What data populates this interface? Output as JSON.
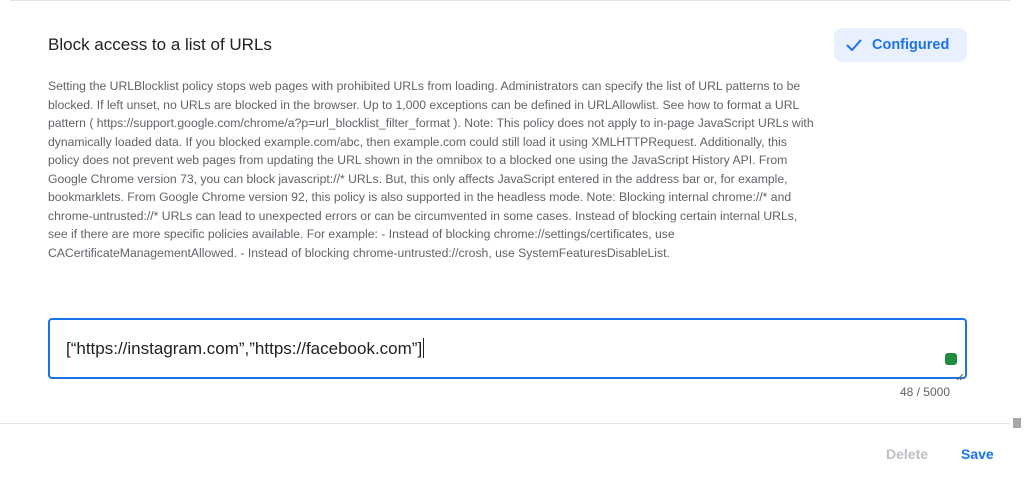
{
  "policy": {
    "title": "Block access to a list of URLs",
    "status_label": "Configured",
    "description": "Setting the URLBlocklist policy stops web pages with prohibited URLs from loading. Administrators can specify the list of URL patterns to be blocked. If left unset, no URLs are blocked in the browser. Up to 1,000 exceptions can be defined in URLAllowlist. See how to format a URL pattern ( https://support.google.com/chrome/a?p=url_blocklist_filter_format ). Note: This policy does not apply to in-page JavaScript URLs with dynamically loaded data. If you blocked example.com/abc, then example.com could still load it using XMLHTTPRequest. Additionally, this policy does not prevent web pages from updating the URL shown in the omnibox to a blocked one using the JavaScript History API. From Google Chrome version 73, you can block javascript://* URLs. But, this only affects JavaScript entered in the address bar or, for example, bookmarklets. From Google Chrome version 92, this policy is also supported in the headless mode. Note: Blocking internal chrome://* and chrome-untrusted://* URLs can lead to unexpected errors or can be circumvented in some cases. Instead of blocking certain internal URLs, see if there are more specific policies available. For example: - Instead of blocking chrome://settings/certificates, use CACertificateManagementAllowed. - Instead of blocking chrome-untrusted://crosh, use SystemFeaturesDisableList."
  },
  "editor": {
    "value": "[“https://instagram.com”,”https://facebook.com”]",
    "char_count": "48 / 5000"
  },
  "actions": {
    "delete_label": "Delete",
    "save_label": "Save"
  },
  "icons": {
    "status": "check-icon",
    "extension": "extension-badge-icon",
    "resize": "resize-handle-icon"
  },
  "colors": {
    "accent": "#1a73e8",
    "chip_background": "#e8f0fe",
    "disabled_text": "#bdc1c6",
    "body_text": "#5f6368",
    "extension_badge": "#1e8e3e"
  }
}
